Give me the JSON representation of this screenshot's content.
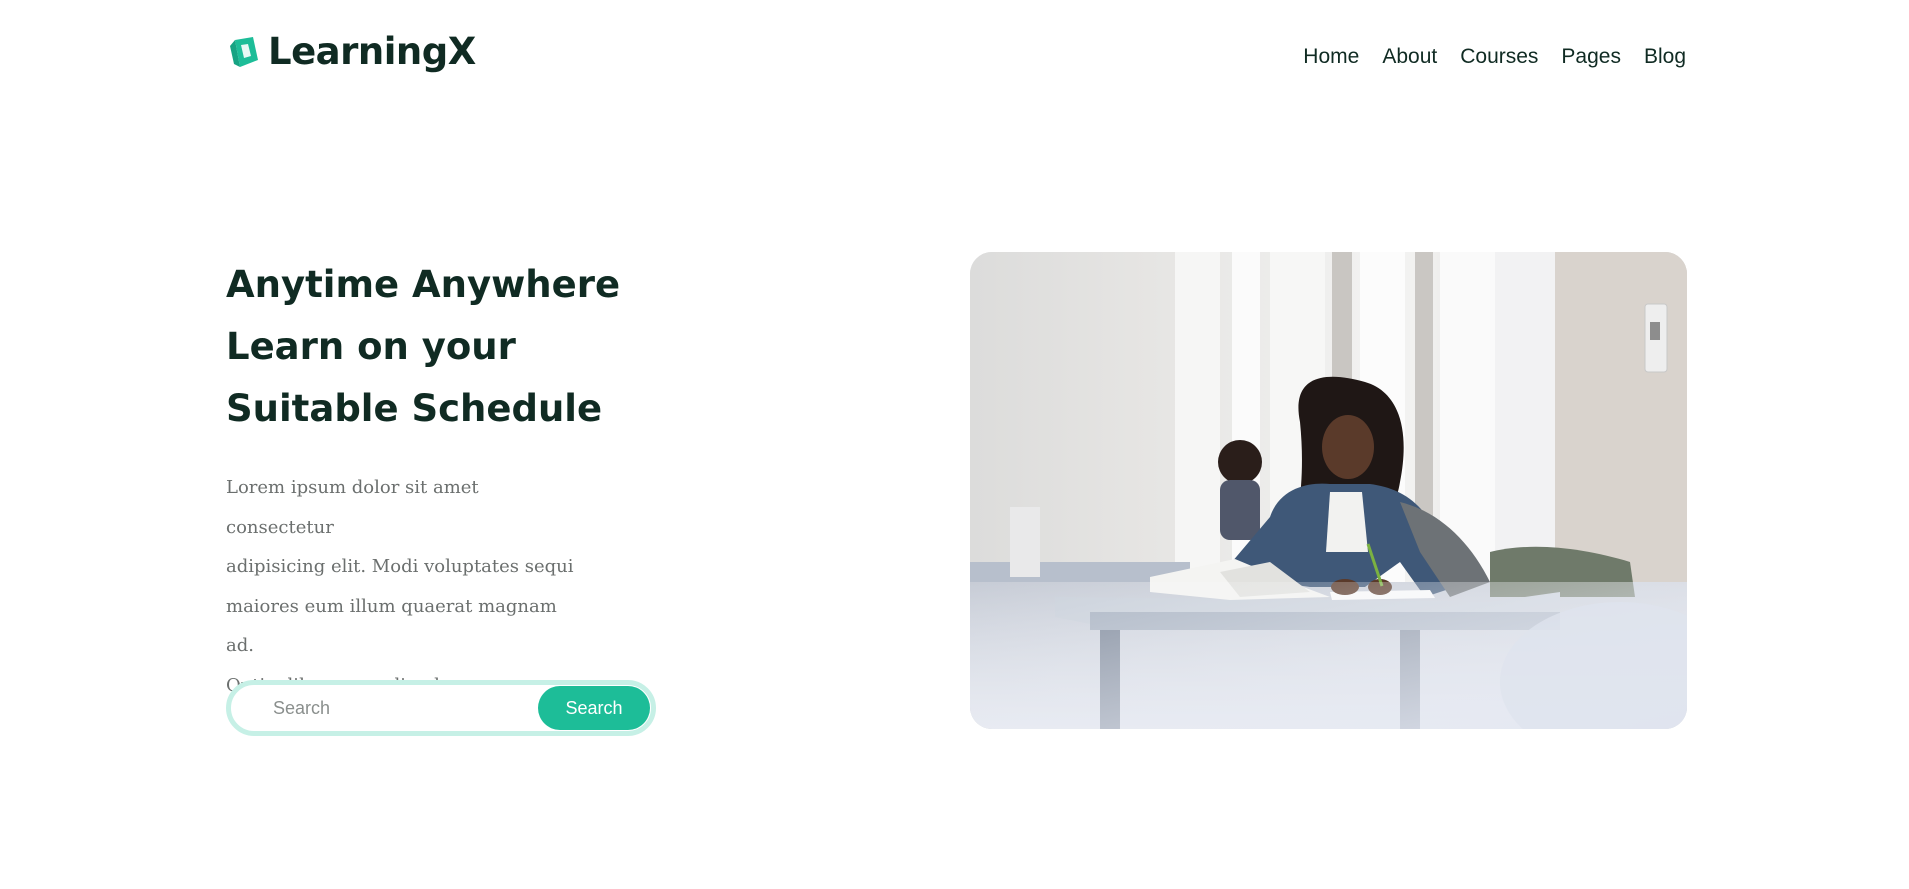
{
  "header": {
    "brand": {
      "name": "LearningX",
      "icon": "book-logo-icon"
    },
    "nav": [
      {
        "label": "Home"
      },
      {
        "label": "About"
      },
      {
        "label": "Courses"
      },
      {
        "label": "Pages"
      },
      {
        "label": "Blog"
      }
    ]
  },
  "hero": {
    "title_lines": [
      "Anytime Anywhere",
      "Learn on your",
      "Suitable Schedule"
    ],
    "text_lines": [
      "Lorem ipsum dolor sit amet consectetur",
      "adipisicing elit. Modi voluptates sequi",
      "maiores eum illum quaerat magnam ad.",
      "Optio, libero repudiandae."
    ],
    "search": {
      "placeholder": "Search",
      "value": "",
      "button_label": "Search"
    },
    "image": {
      "subject": "student-studying-photo"
    }
  },
  "colors": {
    "accent": "#1dbd98",
    "accent_light": "#c6f0e6",
    "heading": "#102b23",
    "body_text": "#6b6f6e"
  }
}
